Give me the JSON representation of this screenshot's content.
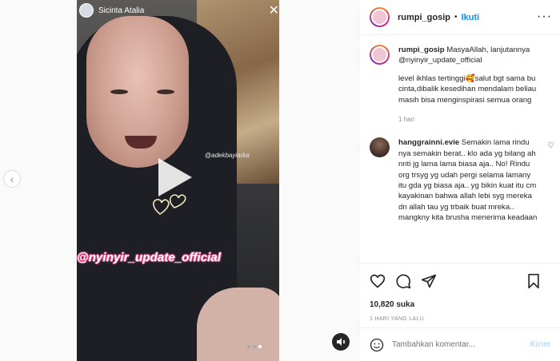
{
  "story": {
    "author_name": "Sicinta Atalia",
    "watermark_small": "@adekbayiarka",
    "tag_text": "@nyinyir_update_official",
    "carousel_count": 3,
    "carousel_active_index": 2
  },
  "panel": {
    "header": {
      "username": "rumpi_gosip",
      "separator": "•",
      "follow_label": "Ikuti"
    },
    "caption": {
      "username": "rumpi_gosip",
      "line1": "MasyaAllah, lanjutannya @nyinyir_update_official",
      "line2": "level ikhlas tertinggi🥰salut bgt sama bu cinta,dibalik kesedihan mendalam beliau masih bisa menginspirasi semua orang",
      "time": "1 hari"
    },
    "comment": {
      "username": "hanggrainni.evie",
      "text": "Semakin lama rindu nya semakin berat.. klo ada yg bilang ah nnti jg lama lama biasa aja.. No! Rindu org trsyg yg udah pergi selama lamany itu gda yg biasa aja.. yg bikin kuat itu cm kayakinan bahwa allah lebi syg mereka dn allah tau yg trbaik buat mreka.. mangkny kita brusha menerima keadaan"
    },
    "likes": "10,820 suka",
    "posted": "1 HARI YANG LALU",
    "composer": {
      "placeholder": "Tambahkan komentar...",
      "post_label": "Kirim"
    }
  },
  "colors": {
    "accent_blue": "#0095f6",
    "tag_pink": "#ea4c89"
  },
  "icons": [
    "chevron-left-icon",
    "close-icon",
    "play-icon",
    "more-icon",
    "heart-icon",
    "comment-icon",
    "share-icon",
    "save-icon",
    "emoji-icon",
    "sound-icon"
  ]
}
